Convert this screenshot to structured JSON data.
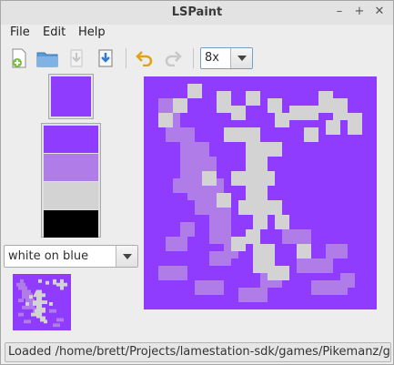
{
  "window": {
    "title": "LSPaint",
    "controls": [
      {
        "name": "minimize-button",
        "glyph": "–"
      },
      {
        "name": "maximize-button",
        "glyph": "+"
      },
      {
        "name": "close-button",
        "glyph": "✕"
      }
    ]
  },
  "menu": {
    "items": [
      "File",
      "Edit",
      "Help"
    ]
  },
  "toolbar": {
    "buttons": [
      "new-file-icon",
      "open-folder-icon",
      "save-icon-disabled",
      "save-as-icon",
      "undo-icon",
      "redo-icon-disabled"
    ],
    "zoom": "8x"
  },
  "colors": {
    "foreground": "#8f3cff",
    "palette": [
      "#8f3cff",
      "#b07de8",
      "#d3d3d3",
      "#000000"
    ],
    "accent": "#7a9cc8"
  },
  "scheme": {
    "value": "white on blue"
  },
  "status": {
    "message": "Loaded /home/brett/Projects/lamestation-sdk/games/Pikemanz/ghost"
  }
}
